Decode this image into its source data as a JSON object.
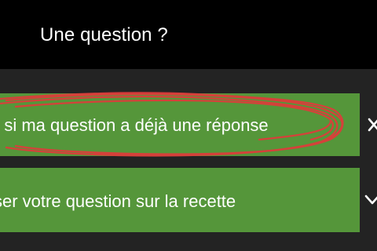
{
  "header": {
    "title": "Une question ?"
  },
  "faq": {
    "items": [
      {
        "label": "ir si ma question a déjà une réponse",
        "icon": "close-icon"
      },
      {
        "label": "ser votre question sur la recette",
        "icon": "chevron-down-icon"
      }
    ]
  },
  "colors": {
    "header_bg": "#000000",
    "page_bg": "#232323",
    "row_bg": "#55963a",
    "text": "#ffffff",
    "annotation": "#e03a3a"
  }
}
